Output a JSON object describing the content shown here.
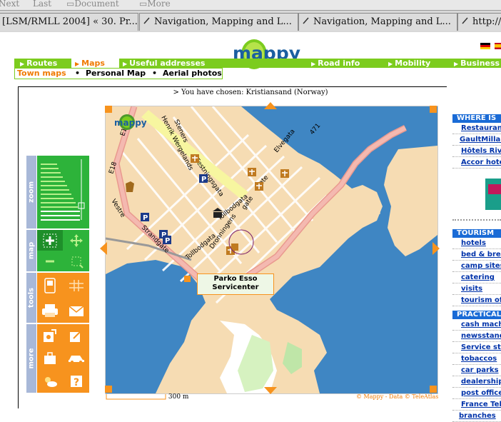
{
  "browser": {
    "toolbar": [
      "Next",
      "Last",
      "Document",
      "More"
    ],
    "tabs": [
      "[LSM/RMLL 2004] « 30. Pr...",
      "Navigation, Mapping and L...",
      "Navigation, Mapping and L...",
      "http://..."
    ]
  },
  "site": {
    "logo_text": "mappy",
    "nav": [
      "Routes",
      "Maps",
      "Useful addresses",
      "Road info",
      "Mobility",
      "Business"
    ],
    "active_nav": "Maps",
    "subnav": [
      "Town maps",
      "Personal Map",
      "Aerial photos"
    ],
    "chosen_prefix": "> You have chosen:",
    "chosen_place": "Kristiansand (Norway)"
  },
  "tools": {
    "zoom_label": "zoom",
    "map_label": "map",
    "tools_label": "tools",
    "more_label": "more"
  },
  "map": {
    "streets": [
      "E18",
      "E18",
      "Vestre",
      "Strandgate",
      "Tollbodgata",
      "Tollbodgata",
      "Dronningens",
      "gate",
      "Festningsgata",
      "Elvegata",
      "471",
      "Henrik Wergelands",
      "Steners",
      "gate"
    ],
    "popup_line1": "Parko Esso",
    "popup_line2": "Servicenter",
    "scale_label": "300 m",
    "copyright": "© Mappy - Data © TeleAtlas"
  },
  "right": {
    "where_head": "WHERE IS",
    "where_links": [
      "Restaurants",
      "GaultMillau",
      "Hôtels Riviera",
      "Accor hotels"
    ],
    "tourism_head": "TOURISM",
    "tourism_links": [
      "hotels",
      "bed & breakfast",
      "camp sites",
      "catering",
      "visits",
      "tourism office"
    ],
    "practical_head": "PRACTICAL",
    "practical_links": [
      "cash machines",
      "newsstands",
      "Service stations",
      "tobaccos",
      "car parks",
      "dealerships",
      "post offices",
      "France Telecom",
      "branches"
    ]
  },
  "colors": {
    "green": "#7ccc1e",
    "orange": "#f7931e",
    "blue": "#1a6bd6",
    "water": "#3f86c3"
  }
}
